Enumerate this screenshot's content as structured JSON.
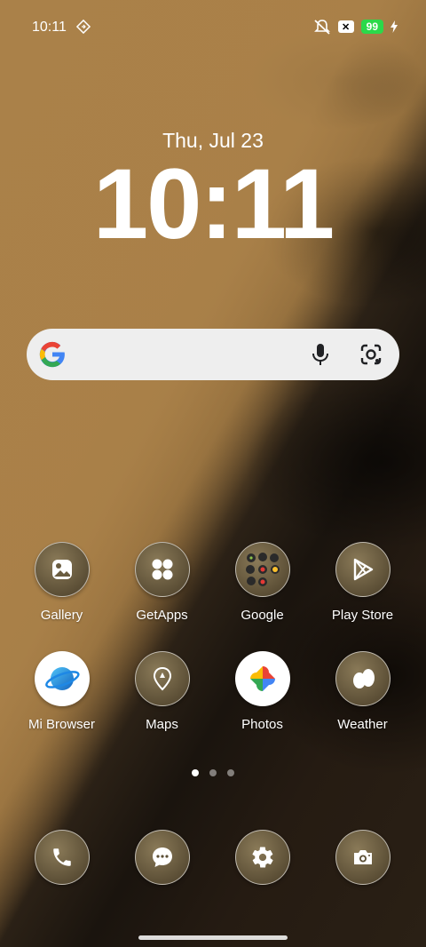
{
  "status_bar": {
    "time": "10:11",
    "battery": "99"
  },
  "lock": {
    "date": "Thu, Jul 23",
    "time": "10:11"
  },
  "search": {
    "placeholder": ""
  },
  "apps_row1": [
    {
      "label": "Gallery",
      "icon": "gallery-icon"
    },
    {
      "label": "GetApps",
      "icon": "getapps-icon"
    },
    {
      "label": "Google",
      "icon": "google-folder-icon"
    },
    {
      "label": "Play Store",
      "icon": "play-store-icon"
    }
  ],
  "apps_row2": [
    {
      "label": "Mi Browser",
      "icon": "mi-browser-icon"
    },
    {
      "label": "Maps",
      "icon": "maps-icon"
    },
    {
      "label": "Photos",
      "icon": "photos-icon"
    },
    {
      "label": "Weather",
      "icon": "weather-icon"
    }
  ],
  "dock": [
    {
      "icon": "phone-icon"
    },
    {
      "icon": "messages-icon"
    },
    {
      "icon": "settings-icon"
    },
    {
      "icon": "camera-icon"
    }
  ],
  "pages": {
    "count": 3,
    "active": 1
  }
}
